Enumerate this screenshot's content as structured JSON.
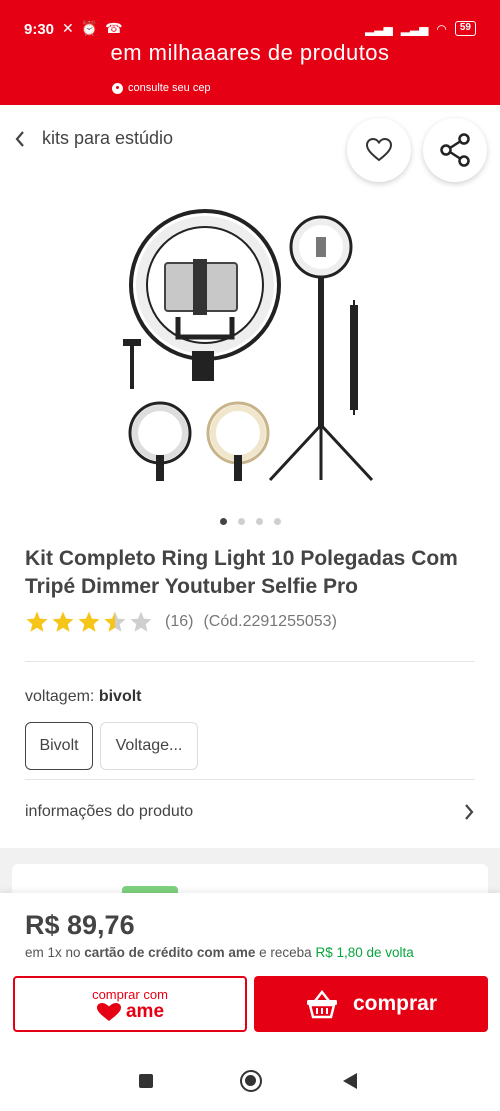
{
  "status_bar": {
    "time": "9:30",
    "battery": "59"
  },
  "header": {
    "headline": "em milhaaares de produtos",
    "cep_link": "consulte seu cep"
  },
  "breadcrumb": {
    "label": "kits para estúdio"
  },
  "product": {
    "title": "Kit Completo Ring Light 10 Polegadas Com Tripé Dimmer Youtuber Selfie Pro",
    "rating": 3.5,
    "rating_max": 5,
    "reviews": "(16)",
    "code": "(Cód.2291255053)",
    "image_count": 4,
    "active_image": 1
  },
  "voltage": {
    "label": "voltagem:",
    "selected": "bivolt",
    "options": [
      "Bivolt",
      "Voltage..."
    ]
  },
  "info": {
    "label": "informações do produto"
  },
  "purchase": {
    "price": "R$ 89,76",
    "installment_prefix": "em 1x no",
    "installment_card": "cartão de crédito com ame",
    "installment_middle": "e receba",
    "cashback": "R$ 1,80 de volta",
    "ame_button_small": "comprar com",
    "ame_logo": "ame",
    "buy_button": "comprar"
  },
  "colors": {
    "brand_red": "#e60014",
    "star": "#f5c518",
    "cashback_green": "#0aa53f"
  }
}
